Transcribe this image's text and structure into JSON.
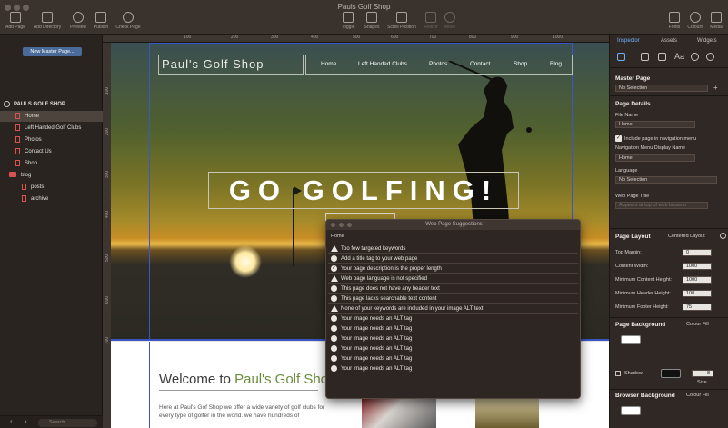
{
  "window": {
    "title": "Pauls Golf Shop"
  },
  "toolbar": {
    "add_page": "Add Page",
    "add_directory": "Add Directory",
    "preview": "Preview",
    "publish": "Publish",
    "check_page": "Check Page",
    "toggle": "Toggle",
    "shapes": "Shapes",
    "scroll_position": "Scroll Position",
    "resize": "Resize",
    "move": "Move",
    "fonts": "Fonts",
    "colours": "Colours",
    "media": "Media"
  },
  "left_panel": {
    "new_master_button": "New Master Page...",
    "site_name": "PAULS GOLF SHOP",
    "pages": [
      {
        "label": "Home"
      },
      {
        "label": "Left Handed Golf Clubs"
      },
      {
        "label": "Photos"
      },
      {
        "label": "Contact Us"
      },
      {
        "label": "Shop"
      },
      {
        "label": "blog"
      },
      {
        "label": "posts"
      },
      {
        "label": "archive"
      }
    ],
    "search_placeholder": "Search"
  },
  "ruler": {
    "top": [
      "100",
      "200",
      "300",
      "400",
      "500",
      "600",
      "700",
      "800",
      "900",
      "1000"
    ],
    "left": [
      "100",
      "200",
      "300",
      "400",
      "500",
      "600",
      "700"
    ]
  },
  "site": {
    "logo": "Paul's Golf Shop",
    "nav": [
      "Home",
      "Left Handed Clubs",
      "Photos",
      "Contact",
      "Shop",
      "Blog"
    ],
    "headline": "GO GOLFING!",
    "welcome_prefix": "Welcome to ",
    "welcome_brand": "Paul's Golf Shop!",
    "intro": "Here at Paul's Gof Shop we offer a wide variety of golf clubs for every type of golfer in the world. we have hundreds of"
  },
  "dialog": {
    "title": "Web Page Suggestions",
    "page": "Home",
    "items": [
      {
        "icon": "warning",
        "text": "Too few targeted keywords"
      },
      {
        "icon": "info",
        "text": "Add a title tag to your web page"
      },
      {
        "icon": "check",
        "text": "Your page description is the proper length"
      },
      {
        "icon": "warning",
        "text": "Web page language is not specified"
      },
      {
        "icon": "info",
        "text": "This page does not have any header text"
      },
      {
        "icon": "info",
        "text": "This page lacks searchable text content"
      },
      {
        "icon": "warning",
        "text": "None of your keywords are included in your image ALT text"
      },
      {
        "icon": "info",
        "text": "Your image needs an ALT tag"
      },
      {
        "icon": "info",
        "text": "Your image needs an ALT tag"
      },
      {
        "icon": "info",
        "text": "Your image needs an ALT tag"
      },
      {
        "icon": "info",
        "text": "Your image needs an ALT tag"
      },
      {
        "icon": "info",
        "text": "Your image needs an ALT tag"
      },
      {
        "icon": "info",
        "text": "Your image needs an ALT tag"
      }
    ]
  },
  "inspector": {
    "tabs": [
      "Inspector",
      "Assets",
      "Widgets"
    ],
    "master_page_title": "Master Page",
    "master_page_value": "No Selection",
    "page_details_title": "Page Details",
    "file_name_label": "File Name",
    "file_name_value": "Home",
    "include_nav_label": "Include page in navigation menu",
    "nav_display_label": "Navigation Menu Display Name",
    "nav_display_value": "Home",
    "language_label": "Language",
    "language_value": "No Selection",
    "web_title_label": "Web Page Title",
    "web_title_placeholder": "Appears at top of web browser",
    "page_layout_title": "Page Layout",
    "page_layout_value": "Centered Layout",
    "top_margin_label": "Top Margin:",
    "top_margin_value": "0",
    "content_width_label": "Content Width:",
    "content_width_value": "1000",
    "min_content_label": "Minimum Content Height:",
    "min_content_value": "1000",
    "min_header_label": "Minimum Header Height:",
    "min_header_value": "100",
    "min_footer_label": "Minimum Footer Height:",
    "min_footer_value": "75",
    "page_bg_title": "Page Background",
    "page_bg_value": "Colour Fill",
    "shadow_label": "Shadow",
    "shadow_size": "8",
    "size_label": "Size",
    "browser_bg_title": "Browser Background",
    "browser_bg_value": "Colour Fill"
  },
  "colors": {
    "accent": "#6fb1ff",
    "brand_green": "#6b8c3b",
    "guide": "#3a57c5",
    "error": "#d9534f"
  }
}
